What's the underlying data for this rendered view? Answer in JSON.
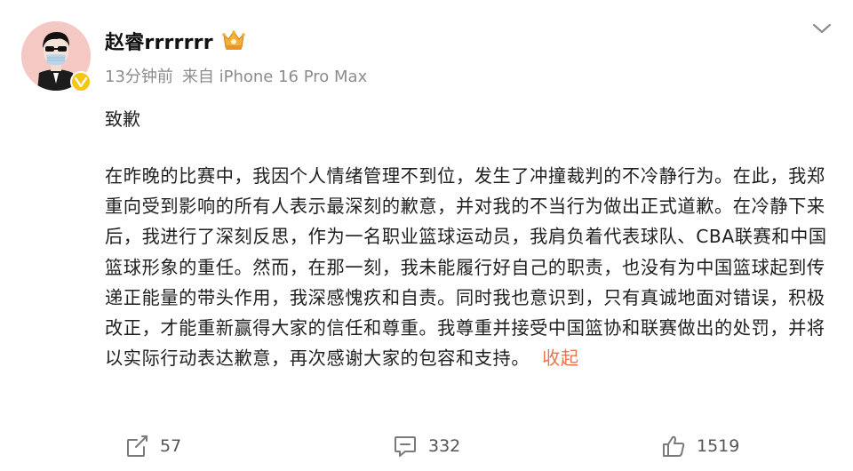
{
  "user": {
    "name": "赵睿rrrrrrr",
    "avatar_icon": "avatar-cartoon-masked-man",
    "badge_icon": "fan-club-badge-icon",
    "verified_icon": "verified-v-icon",
    "verified_color": "#f5c518"
  },
  "meta": {
    "time": "13分钟前",
    "source": "来自 iPhone 16 Pro Max"
  },
  "post": {
    "title": "致歉",
    "body": "在昨晚的比赛中，我因个人情绪管理不到位，发生了冲撞裁判的不冷静行为。在此，我郑重向受到影响的所有人表示最深刻的歉意，并对我的不当行为做出正式道歉。在冷静下来后，我进行了深刻反思，作为一名职业篮球运动员，我肩负着代表球队、CBA联赛和中国篮球形象的重任。然而，在那一刻，我未能履行好自己的职责，也没有为中国篮球起到传递正能量的带头作用，我深感愧疚和自责。同时我也意识到，只有真诚地面对错误，积极改正，才能重新赢得大家的信任和尊重。我尊重并接受中国篮协和联赛做出的处罚，并将以实际行动表达歉意，再次感谢大家的包容和支持。",
    "collapse_label": "收起",
    "link_color": "#eb7350"
  },
  "actions": {
    "repost": {
      "icon": "share-icon",
      "count": "57"
    },
    "comment": {
      "icon": "comment-icon",
      "count": "332"
    },
    "like": {
      "icon": "thumbs-up-icon",
      "count": "1519"
    }
  },
  "menu": {
    "icon": "chevron-down-icon"
  }
}
